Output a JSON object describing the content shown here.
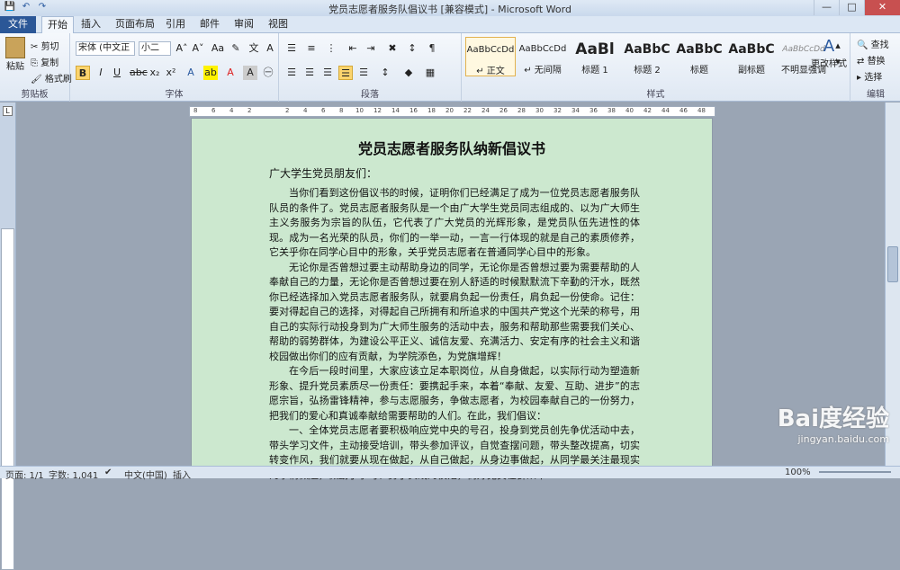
{
  "window": {
    "title": "党员志愿者服务队倡议书 [兼容模式] - Microsoft Word"
  },
  "qat": {
    "save": "💾",
    "undo": "↶",
    "redo": "↷"
  },
  "tabs": [
    {
      "label": "文件"
    },
    {
      "label": "开始"
    },
    {
      "label": "插入"
    },
    {
      "label": "页面布局"
    },
    {
      "label": "引用"
    },
    {
      "label": "邮件"
    },
    {
      "label": "审阅"
    },
    {
      "label": "视图"
    }
  ],
  "clipboard": {
    "paste": "粘贴",
    "cut": "剪切",
    "copy": "复制",
    "format_painter": "格式刷",
    "label": "剪贴板"
  },
  "font": {
    "name": "宋体 (中文正",
    "size": "小二",
    "label": "字体"
  },
  "paragraph": {
    "label": "段落"
  },
  "styles": {
    "items": [
      {
        "preview": "AaBbCcDd",
        "name": "↵ 正文"
      },
      {
        "preview": "AaBbCcDd",
        "name": "↵ 无间隔"
      },
      {
        "preview": "AaBl",
        "name": "标题 1"
      },
      {
        "preview": "AaBbC",
        "name": "标题 2"
      },
      {
        "preview": "AaBbC",
        "name": "标题"
      },
      {
        "preview": "AaBbC",
        "name": "副标题"
      },
      {
        "preview": "AaBbCcDd",
        "name": "不明显强调"
      }
    ],
    "change": "更改样式",
    "label": "样式"
  },
  "editing": {
    "find": "查找",
    "replace": "替换",
    "select": "选择",
    "label": "编辑"
  },
  "ruler": {
    "ticks": [
      "8",
      "6",
      "4",
      "2",
      "2",
      "4",
      "6",
      "8",
      "10",
      "12",
      "14",
      "16",
      "18",
      "20",
      "22",
      "24",
      "26",
      "28",
      "30",
      "32",
      "34",
      "36",
      "38",
      "40",
      "42",
      "44",
      "46",
      "48"
    ]
  },
  "document": {
    "title": "党员志愿者服务队纳新倡议书",
    "greeting": "广大学生党员朋友们：",
    "paragraphs": [
      "当你们看到这份倡议书的时候，证明你们已经满足了成为一位党员志愿者服务队队员的条件了。党员志愿者服务队是一个由广大学生党员同志组成的、以为广大师生主义务服务为宗旨的队伍，它代表了广大党员的光辉形象，是党员队伍先进性的体现。成为一名光荣的队员，你们的一举一动，一言一行体现的就是自己的素质修养，它关乎你在同学心目中的形象，关乎党员志愿者在普通同学心目中的形象。",
      "无论你是否曾想过要主动帮助身边的同学，无论你是否曾想过要为需要帮助的人奉献自己的力量，无论你是否曾想过要在别人舒适的时候默默流下辛勤的汗水，既然你已经选择加入党员志愿者服务队，就要肩负起一份责任，肩负起一份使命。记住：要对得起自己的选择，对得起自己所拥有和所追求的中国共产党这个光荣的称号，用自己的实际行动投身到为广大师生服务的活动中去，服务和帮助那些需要我们关心、帮助的弱势群体，为建设公平正义、诚信友爱、充满活力、安定有序的社会主义和谐校园做出你们的应有贡献，为学院添色，为党旗增辉！",
      "在今后一段时间里，大家应该立足本职岗位，从自身做起，以实际行动为塑造新形象、提升党员素质尽一份责任：要携起手来，本着“奉献、友爱、互助、进步”的志愿宗旨，弘扬雷锋精神，参与志愿服务，争做志愿者，为校园奉献自己的一份努力，把我们的爱心和真诚奉献给需要帮助的人们。在此，我们倡议：",
      "一、全体党员志愿者要积极响应党中央的号召，投身到党员创先争优活动中去，带头学习文件，主动接受培训，带头参加评议，自觉查摆问题，带头整改提高，切实转变作风，我们就要从现在做起，从自己做起，从身边事做起，从同学最关注最现实的事情做起，做勤于学习、勇于实践的模范，树好党员在群众中"
    ]
  },
  "status": {
    "page": "页面: 1/1",
    "words": "字数: 1,041",
    "lang": "中文(中国)",
    "mode": "插入",
    "zoom": "100%"
  },
  "watermark": {
    "brand": "Bai度经验",
    "url": "jingyan.baidu.com"
  }
}
